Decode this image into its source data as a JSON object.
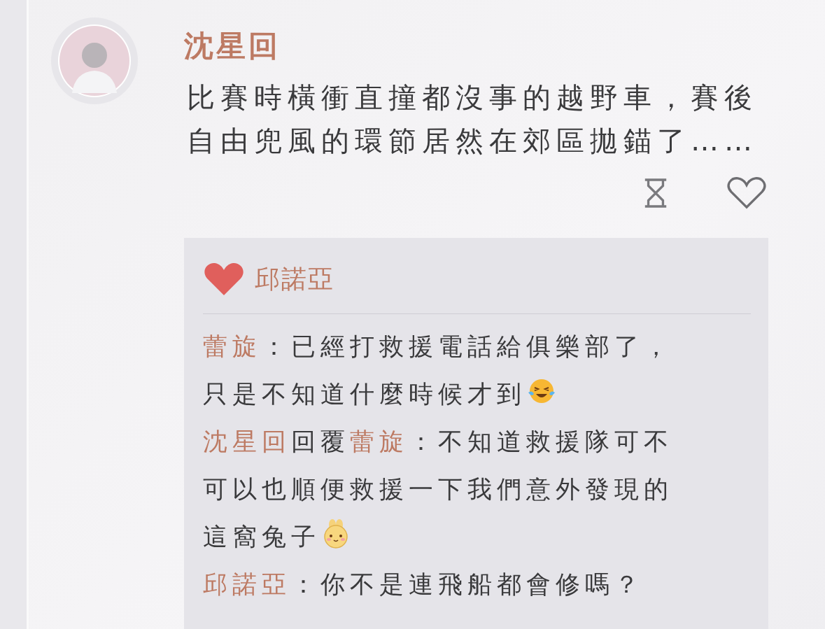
{
  "post": {
    "author": "沈星回",
    "text": "比賽時橫衝直撞都沒事的越野車，賽後自由兜風的環節居然在郊區拋錨了……",
    "liked": false
  },
  "replies": {
    "likes": [
      "邱諾亞"
    ],
    "comments": [
      {
        "author": "蕾旋",
        "lines": [
          "：已經打救援電話給俱樂部了，",
          "只是不知道什麼時候才到"
        ],
        "emoji": {
          "kind": "laugh-cry"
        }
      },
      {
        "author": "沈星回",
        "reply_word": "回覆",
        "reply_to": "蕾旋",
        "lines": [
          "：不知道救援隊可不",
          "可以也順便救援一下我們意外發現的",
          "這窩兔子"
        ],
        "emoji": {
          "kind": "bunny"
        }
      },
      {
        "author": "邱諾亞",
        "lines": [
          "：你不是連飛船都會修嗎？"
        ]
      }
    ]
  }
}
